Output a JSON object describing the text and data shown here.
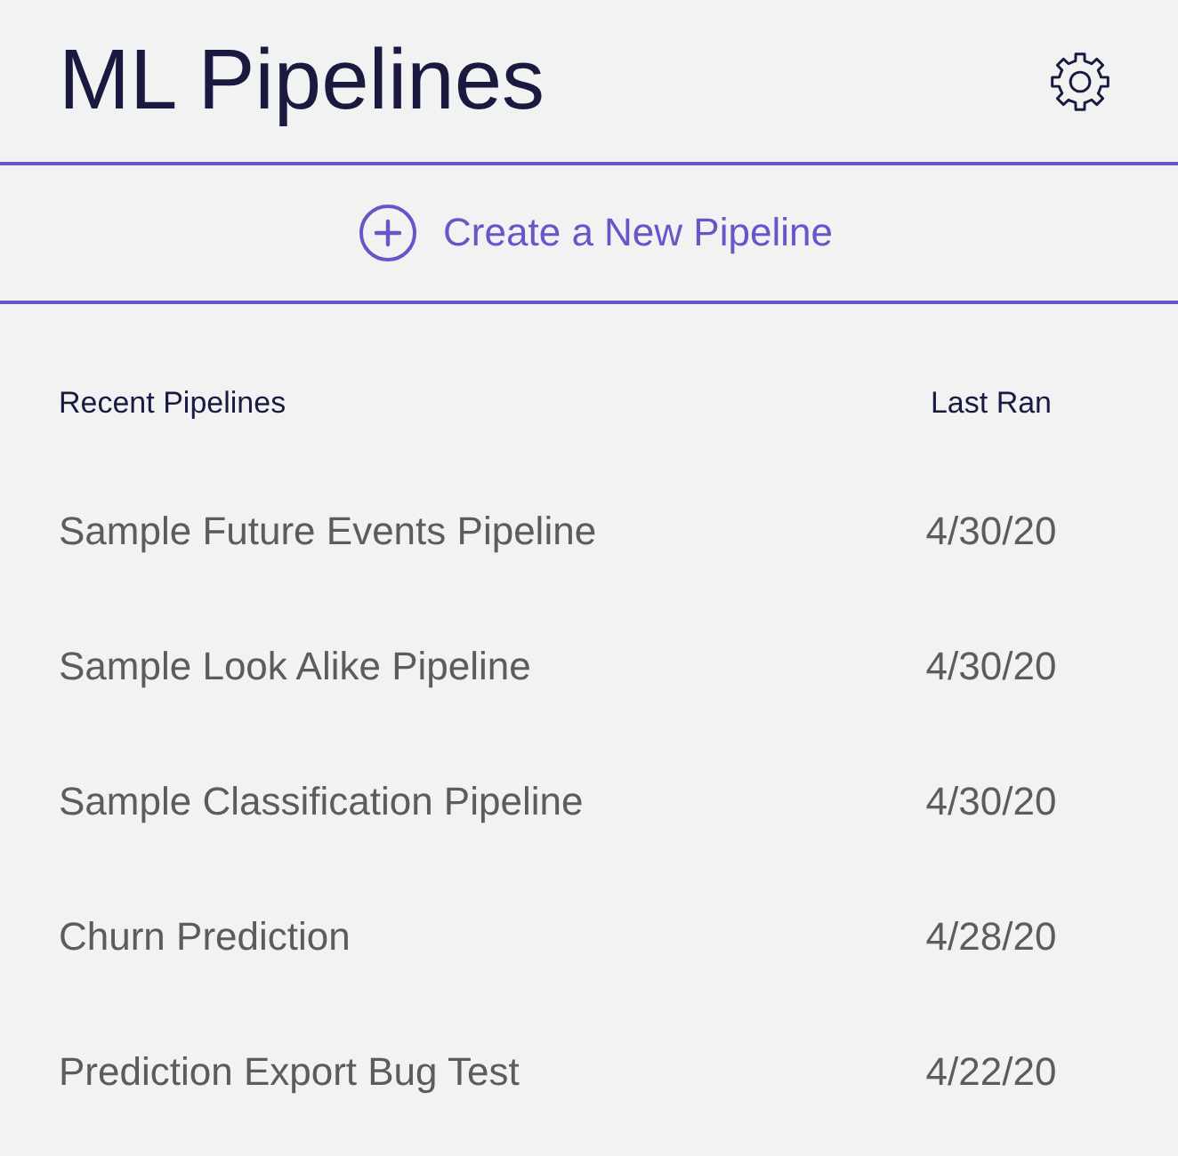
{
  "header": {
    "title": "ML Pipelines"
  },
  "create_button": {
    "label": "Create a New Pipeline"
  },
  "table": {
    "columns": [
      "Recent Pipelines",
      "Last Ran"
    ],
    "rows": [
      {
        "name": "Sample Future Events Pipeline",
        "last_ran": "4/30/20"
      },
      {
        "name": "Sample Look Alike Pipeline",
        "last_ran": "4/30/20"
      },
      {
        "name": "Sample Classification Pipeline",
        "last_ran": "4/30/20"
      },
      {
        "name": "Churn Prediction",
        "last_ran": "4/28/20"
      },
      {
        "name": "Prediction Export Bug Test",
        "last_ran": "4/22/20"
      }
    ]
  }
}
